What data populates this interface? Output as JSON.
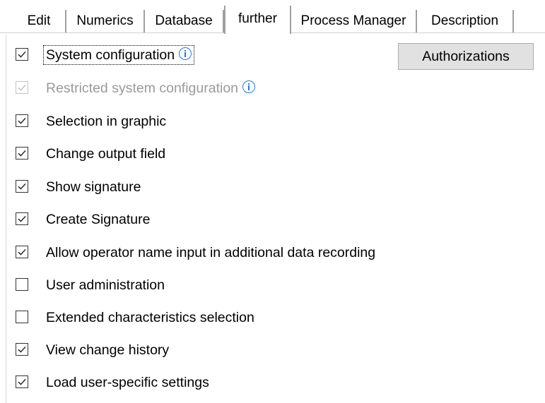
{
  "tabs": [
    {
      "label": "Edit",
      "active": false
    },
    {
      "label": "Numerics",
      "active": false
    },
    {
      "label": "Database",
      "active": false
    },
    {
      "label": "further",
      "active": true
    },
    {
      "label": "Process Manager",
      "active": false
    },
    {
      "label": "Description",
      "active": false
    }
  ],
  "authorizations_label": "Authorizations",
  "options": [
    {
      "label": "System configuration",
      "checked": true,
      "enabled": true,
      "info": true,
      "focused": true
    },
    {
      "label": "Restricted system configuration",
      "checked": true,
      "enabled": false,
      "info": true
    },
    {
      "label": "Selection in graphic",
      "checked": true,
      "enabled": true
    },
    {
      "label": "Change output field",
      "checked": true,
      "enabled": true
    },
    {
      "label": "Show signature",
      "checked": true,
      "enabled": true
    },
    {
      "label": "Create Signature",
      "checked": true,
      "enabled": true
    },
    {
      "label": "Allow operator name input in additional data recording",
      "checked": true,
      "enabled": true
    },
    {
      "label": "User administration",
      "checked": false,
      "enabled": true
    },
    {
      "label": "Extended characteristics selection",
      "checked": false,
      "enabled": true
    },
    {
      "label": "View change history",
      "checked": true,
      "enabled": true
    },
    {
      "label": "Load user-specific settings",
      "checked": true,
      "enabled": true
    }
  ],
  "colors": {
    "info_accent": "#1e7bd8",
    "check": "#333333",
    "disabled": "#9a9a9a"
  }
}
